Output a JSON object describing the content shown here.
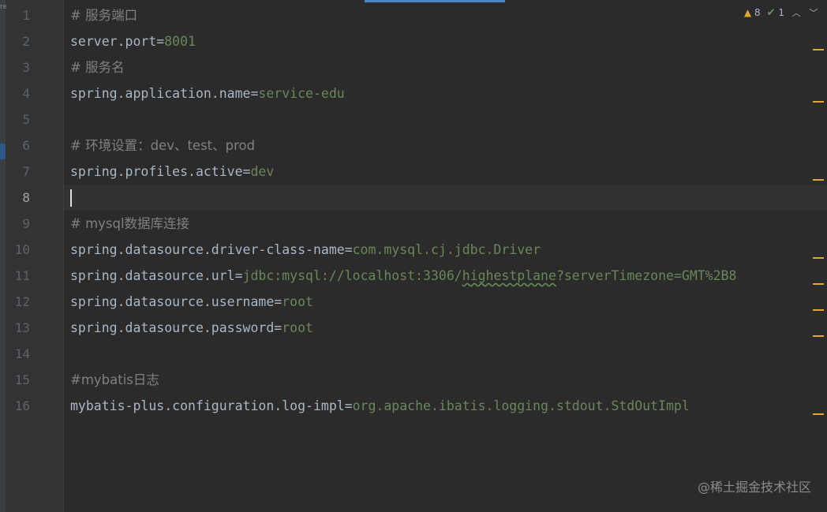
{
  "inspection": {
    "warnings_count": "8",
    "typos_count": "1",
    "warning_icon": "warning-triangle-icon",
    "check_icon": "check-icon",
    "colors": {
      "warning": "#e0a82e",
      "ok": "#5f9e5a"
    }
  },
  "lines": [
    {
      "num": "1",
      "comment": "# 服务端口"
    },
    {
      "num": "2",
      "key": "server.port",
      "eq": "=",
      "value": "8001"
    },
    {
      "num": "3",
      "comment": "# 服务名"
    },
    {
      "num": "4",
      "key": "spring.application.name",
      "eq": "=",
      "value": "service-edu"
    },
    {
      "num": "5"
    },
    {
      "num": "6",
      "comment": "# 环境设置：dev、test、prod"
    },
    {
      "num": "7",
      "key": "spring.profiles.active",
      "eq": "=",
      "value": "dev"
    },
    {
      "num": "8"
    },
    {
      "num": "9",
      "comment": "# mysql数据库连接"
    },
    {
      "num": "10",
      "key": "spring.datasource.driver-class-name",
      "eq": "=",
      "value": "com.mysql.cj.jdbc.Driver"
    },
    {
      "num": "11",
      "key": "spring.datasource.url",
      "eq": "=",
      "value_pre": "jdbc:mysql://localhost:3306/",
      "value_typo": "highestplane",
      "value_post": "?serverTimezone=GMT%2B8"
    },
    {
      "num": "12",
      "key": "spring.datasource.username",
      "eq": "=",
      "value": "root"
    },
    {
      "num": "13",
      "key": "spring.datasource.password",
      "eq": "=",
      "value": "root"
    },
    {
      "num": "14"
    },
    {
      "num": "15",
      "comment": "#mybatis日志"
    },
    {
      "num": "16",
      "key": "mybatis-plus.configuration.log-impl",
      "eq": "=",
      "value": "org.apache.ibatis.logging.stdout.StdOutImpl"
    }
  ],
  "current_line": "8",
  "watermark": "@稀土掘金技术社区",
  "colors": {
    "background": "#2b2b2b",
    "gutter": "#313335",
    "comment": "#808080",
    "key": "#a9b7c6",
    "value": "#6a8759",
    "line_number": "#606366"
  }
}
